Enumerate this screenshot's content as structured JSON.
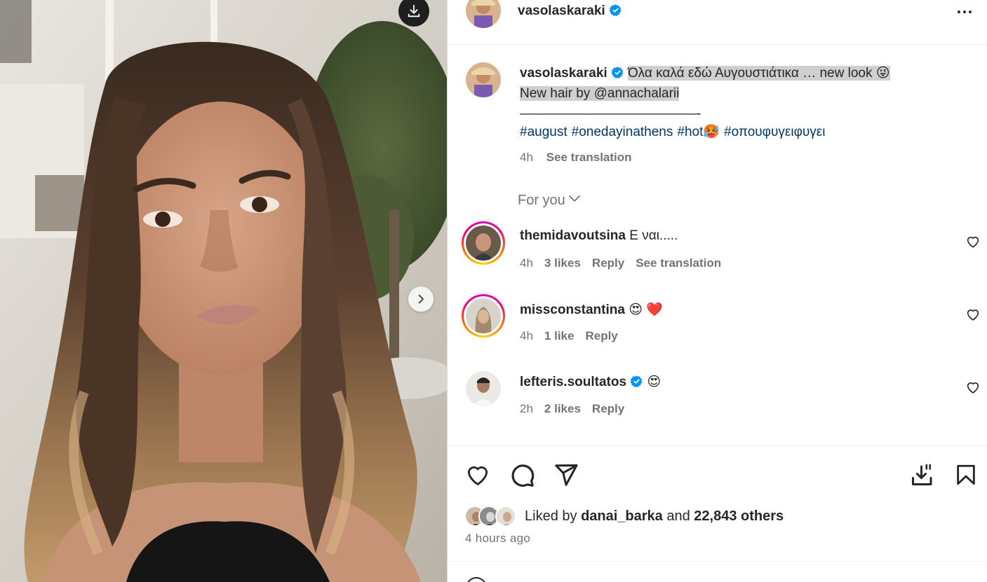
{
  "post": {
    "author": "vasolaskaraki",
    "verified": true
  },
  "caption": {
    "username": "vasolaskaraki",
    "line1": "Όλα καλά εδώ Αυγουστιάτικα … new look 😜",
    "line2": "New hair by @annachalarii",
    "line3": "——————————————-",
    "hashtags": [
      "#august",
      "#onedayinathens",
      "#hot🥵",
      "#οπουφυγειφυγει"
    ],
    "time": "4h",
    "see_translation": "See translation"
  },
  "for_you": "For you",
  "comments": [
    {
      "username": "themidavoutsina",
      "text": "Ε ναι.....",
      "time": "4h",
      "likes": "3 likes",
      "reply": "Reply",
      "translate": "See translation",
      "story_ring": true,
      "verified": false
    },
    {
      "username": "missconstantina",
      "text": "😍 ❤️",
      "time": "4h",
      "likes": "1 like",
      "reply": "Reply",
      "translate": "",
      "story_ring": true,
      "verified": false
    },
    {
      "username": "lefteris.soultatos",
      "text": "😍",
      "time": "2h",
      "likes": "2 likes",
      "reply": "Reply",
      "translate": "",
      "story_ring": false,
      "verified": true
    }
  ],
  "likes": {
    "prefix": "Liked by",
    "user": "danai_barka",
    "middle": "and",
    "others": "22,843 others"
  },
  "time_ago": "4 hours ago",
  "colors": {
    "text": "#262626",
    "secondary": "#737373",
    "hashtag": "#00376b",
    "verified": "#0095f6",
    "highlight": "#cfcfcf"
  },
  "icons": [
    "download-icon",
    "chevron-right-icon",
    "more-icon",
    "verified-icon",
    "heart-icon",
    "comment-icon",
    "share-icon",
    "save-to-collection-icon",
    "bookmark-icon",
    "chevron-down-icon"
  ]
}
